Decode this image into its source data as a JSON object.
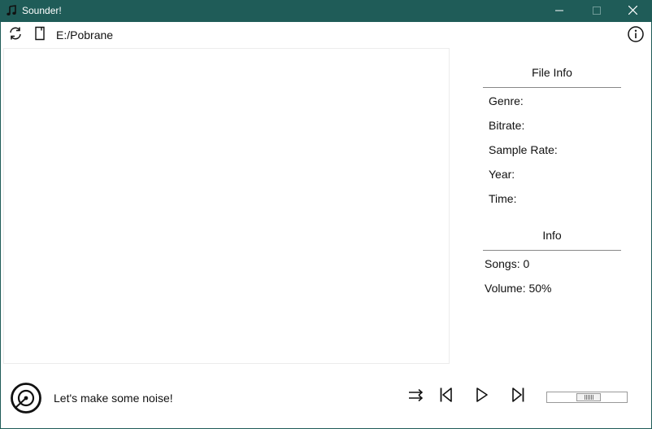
{
  "window": {
    "title": "Sounder!",
    "title_icon": "music-note-icon",
    "buttons": [
      "minimize-icon",
      "maximize-icon",
      "close-icon"
    ],
    "title_color": "#1f5c58"
  },
  "toolbar": {
    "refresh_icon": "refresh-icon",
    "open_folder_icon": "folder-open-icon",
    "path": "E:/Pobrane",
    "info_icon": "info-icon"
  },
  "song_list": {
    "items": []
  },
  "file_info": {
    "title": "File Info",
    "rows": [
      {
        "label": "Genre:",
        "value": ""
      },
      {
        "label": "Bitrate:",
        "value": ""
      },
      {
        "label": "Sample Rate:",
        "value": ""
      },
      {
        "label": "Year:",
        "value": ""
      },
      {
        "label": "Time:",
        "value": ""
      }
    ]
  },
  "info": {
    "title": "Info",
    "songs_label": "Songs:",
    "songs_value": "0",
    "volume_label": "Volume:",
    "volume_value": "50%"
  },
  "player": {
    "disc_icon": "disc-icon",
    "now_playing": "Let's make some noise!",
    "controls": [
      "shuffle-icon",
      "previous-icon",
      "play-icon",
      "next-icon"
    ],
    "volume_level": 0.5
  }
}
